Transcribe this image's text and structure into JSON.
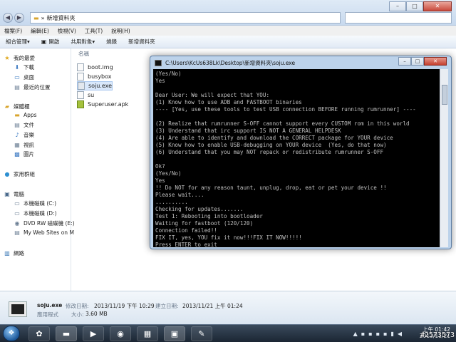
{
  "explorer": {
    "address_path": "新增資料夾",
    "menu": [
      "檔案(F)",
      "編輯(E)",
      "檢視(V)",
      "工具(T)",
      "說明(H)"
    ],
    "toolbar": [
      "組合管理",
      "開啟",
      "共用對象",
      "燒錄",
      "新增資料夾"
    ],
    "nav": {
      "favorites": "我的最愛",
      "favorites_items": [
        "下載",
        "桌面",
        "最近的位置"
      ],
      "libraries": "媒體櫃",
      "libraries_items": [
        "Apps",
        "文件",
        "音樂",
        "視訊",
        "圖片"
      ],
      "homegroup": "家用群組",
      "computer": "電腦",
      "computer_items": [
        "本機磁碟 (C:)",
        "本機磁碟 (D:)",
        "DVD RW 磁碟機 (E:)",
        "My Web Sites on M"
      ],
      "network": "網路"
    },
    "column_header": "名稱",
    "files": [
      {
        "name": "boot.img",
        "icon": "file-icon"
      },
      {
        "name": "busybox",
        "icon": "file-icon"
      },
      {
        "name": "soju.exe",
        "icon": "exe-icon"
      },
      {
        "name": "su",
        "icon": "file-icon"
      },
      {
        "name": "Superuser.apk",
        "icon": "apk-icon"
      }
    ],
    "details": {
      "filename": "soju.exe",
      "modified_label": "修改日期:",
      "modified_value": "2013/11/19 下午 10:29",
      "created_label": "建立日期:",
      "created_value": "2013/11/21 上午 01:24",
      "type": "應用程式",
      "size_label": "大小:",
      "size_value": "3.60 MB"
    }
  },
  "console": {
    "title": "C:\\Users\\KcUs638Lk\\Desktop\\新增資料夾\\soju.exe",
    "lines": [
      "(Yes/No)",
      "Yes",
      "",
      "Dear User: We will expect that YOU:",
      "(1) Know how to use ADB and FASTBOOT binaries",
      "---- [Yes, use these tools to test USB connection BEFORE running rumrunner] ----",
      "",
      "(2) Realize that rumrunner S-OFF cannot support every CUSTOM rom in this world",
      "(3) Understand that irc support IS NOT A GENERAL HELPDESK",
      "(4) Are able to identify and download the CORRECT package for YOUR device",
      "(5) Know how to enable USB-debugging on YOUR device  (Yes, do that now)",
      "(6) Understand that you may NOT repack or redistribute rumrunner S-OFF",
      "",
      "Ok?",
      "(Yes/No)",
      "Yes",
      "!! Do NOT for any reason taunt, unplug, drop, eat or pet your device !!",
      "Please wait....",
      "..........",
      "Checking for updates.......",
      "Test 1: Rebooting into bootloader",
      "Waiting for fastboot (120/120)",
      "Connection failed!!",
      "FIX IT, yes, YOU fix it now!!!FIX IT NOW!!!!!",
      "Press ENTER to exit"
    ]
  },
  "taskbar": {
    "clock_time": "上午 01:42",
    "clock_date": "2013/11/21",
    "watermark": "#2573573"
  }
}
